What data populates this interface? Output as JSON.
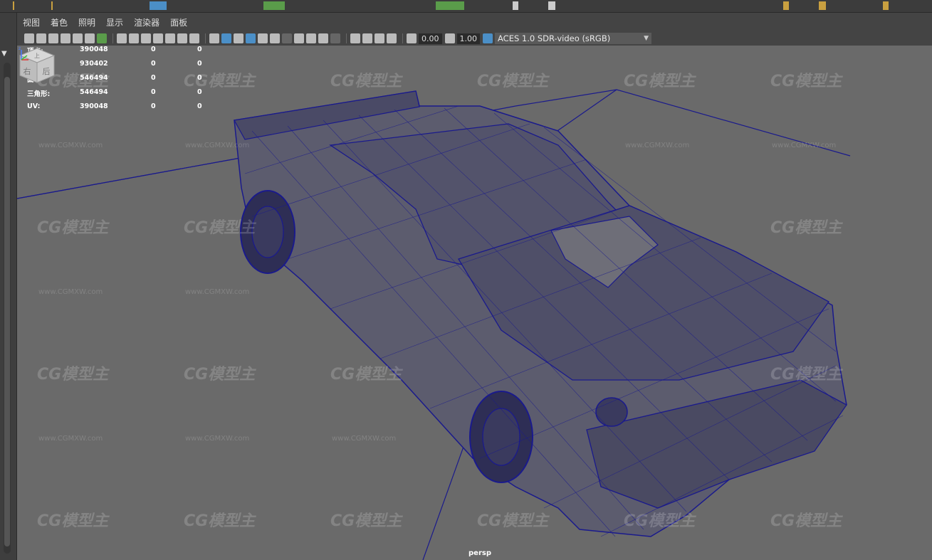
{
  "menu": {
    "items": [
      "视图",
      "着色",
      "照明",
      "显示",
      "渲染器",
      "面板"
    ]
  },
  "toolbar": {
    "exposure_value": "0.00",
    "gamma_value": "1.00",
    "color_space": "ACES 1.0 SDR-video (sRGB)"
  },
  "hud": {
    "rows": [
      {
        "label": "顶点:",
        "v1": "390048",
        "v2": "0",
        "v3": "0"
      },
      {
        "label": "边:",
        "v1": "930402",
        "v2": "0",
        "v3": "0"
      },
      {
        "label": "面:",
        "v1": "546494",
        "v2": "0",
        "v3": "0"
      },
      {
        "label": "三角形:",
        "v1": "546494",
        "v2": "0",
        "v3": "0"
      },
      {
        "label": "UV:",
        "v1": "390048",
        "v2": "0",
        "v3": "0"
      }
    ]
  },
  "viewport": {
    "camera_label": "persp",
    "wire_color": "#1a1a8c",
    "background_color": "#6a6a6a"
  },
  "viewcube": {
    "top_label": "上",
    "right_label": "右",
    "left_label": "后"
  },
  "watermark": {
    "logo_text": "CG模型主",
    "url_text": "www.CGMXW.com"
  }
}
